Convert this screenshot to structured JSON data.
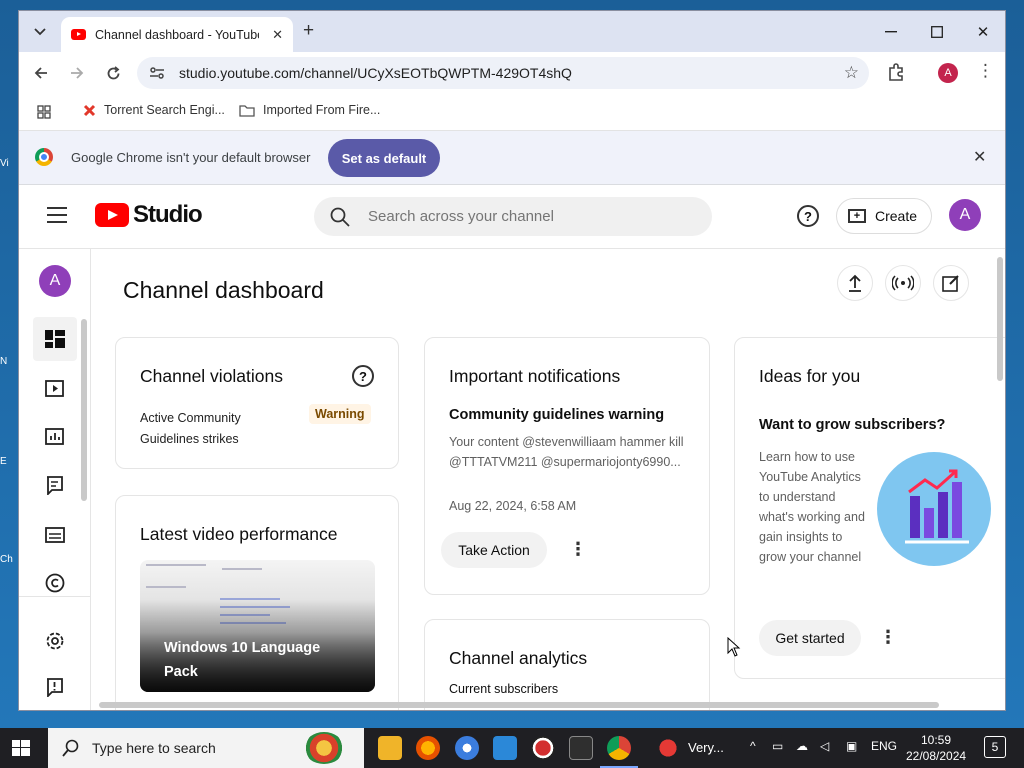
{
  "desktop": {
    "edge_labels": [
      "Vi",
      "N",
      "E",
      "Ch"
    ]
  },
  "browser": {
    "tab_title": "Channel dashboard - YouTube",
    "url": "studio.youtube.com/channel/UCyXsEOTbQWPTM-429OT4shQ",
    "profile_initial": "A",
    "bookmarks": [
      "Torrent Search Engi...",
      "Imported From Fire..."
    ],
    "infobar": {
      "message": "Google Chrome isn't your default browser",
      "button": "Set as default"
    }
  },
  "studio": {
    "logo_text": "Studio",
    "search_placeholder": "Search across your channel",
    "create_label": "Create",
    "avatar_initial": "A",
    "page_title": "Channel dashboard",
    "violations": {
      "title": "Channel violations",
      "text": "Active Community Guidelines strikes",
      "badge": "Warning"
    },
    "notifications": {
      "title": "Important notifications",
      "heading": "Community guidelines warning",
      "body": "Your content @stevenwilliaam hammer kill @TTTATVM211 @supermariojonty6990...",
      "date": "Aug 22, 2024, 6:58 AM",
      "action": "Take Action"
    },
    "ideas": {
      "title": "Ideas for you",
      "heading": "Want to grow subscribers?",
      "body": "Learn how to use YouTube Analytics to understand what's working and gain insights to grow your channel",
      "action": "Get started"
    },
    "latest_video": {
      "title": "Latest video performance",
      "video_title": "Windows 10 Language Pack"
    },
    "analytics": {
      "title": "Channel analytics",
      "subtitle": "Current subscribers"
    }
  },
  "taskbar": {
    "search_placeholder": "Type here to search",
    "active_app_label": "Very...",
    "language": "ENG",
    "time": "10:59",
    "date": "22/08/2024",
    "notification_count": "5"
  },
  "colors": {
    "youtube_red": "#ff0000",
    "avatar_purple": "#8f3fb9",
    "set_default_button": "#5a5aa8",
    "warning_bg": "#fff4e5"
  }
}
